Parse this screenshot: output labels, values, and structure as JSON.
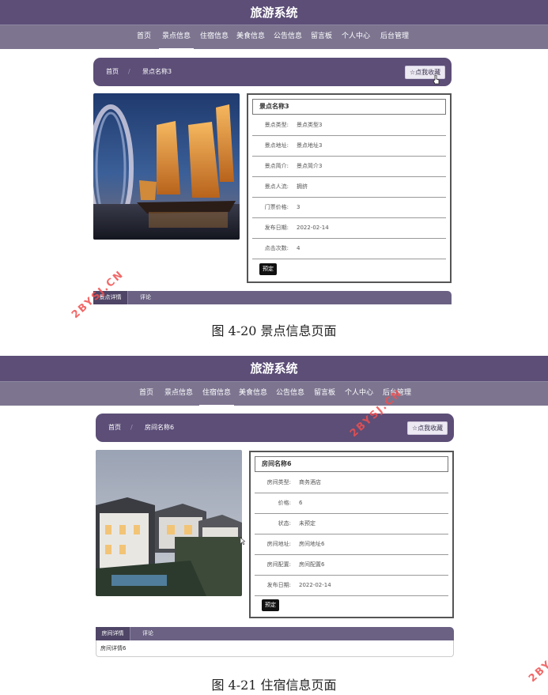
{
  "screens": [
    {
      "site_title": "旅游系统",
      "nav": [
        "首页",
        "景点信息",
        "住宿信息",
        "美食信息",
        "公告信息",
        "留言板",
        "个人中心",
        "后台管理"
      ],
      "active_nav_index": 1,
      "breadcrumb": {
        "home": "首页",
        "separator": "/",
        "current": "景点名称3"
      },
      "favorite_button": "☆点我收藏",
      "info_title": "景点名称3",
      "fields": [
        {
          "label": "景点类型:",
          "value": "景点类型3"
        },
        {
          "label": "景点地址:",
          "value": "景点地址3"
        },
        {
          "label": "景点简介:",
          "value": "景点简介3"
        },
        {
          "label": "景点人流:",
          "value": "拥挤"
        },
        {
          "label": "门票价格:",
          "value": "3"
        },
        {
          "label": "发布日期:",
          "value": "2022-02-14"
        },
        {
          "label": "点击次数:",
          "value": "4"
        }
      ],
      "book_button": "预定",
      "tabs": [
        "景点详情",
        "评论"
      ],
      "caption": "图 4-20 景点信息页面"
    },
    {
      "site_title": "旅游系统",
      "nav": [
        "首页",
        "景点信息",
        "住宿信息",
        "美食信息",
        "公告信息",
        "留言板",
        "个人中心",
        "后台管理"
      ],
      "active_nav_index": 2,
      "breadcrumb": {
        "home": "首页",
        "separator": "/",
        "current": "房间名称6"
      },
      "favorite_button": "☆点我收藏",
      "info_title": "房间名称6",
      "fields": [
        {
          "label": "房间类型:",
          "value": "商务酒店"
        },
        {
          "label": "价格:",
          "value": "6"
        },
        {
          "label": "状态:",
          "value": "未预定"
        },
        {
          "label": "房间地址:",
          "value": "房间地址6"
        },
        {
          "label": "房间配置:",
          "value": "房间配置6"
        },
        {
          "label": "发布日期:",
          "value": "2022-02-14"
        }
      ],
      "book_button": "预定",
      "tabs": [
        "房间详情",
        "评论"
      ],
      "detail_text": "房间详情6",
      "caption": "图 4-21 住宿信息页面"
    }
  ],
  "watermarks": [
    "2BYSJ.CN",
    "2BYSJ.CN",
    "2BY"
  ],
  "colors": {
    "header": "#5c4e77",
    "nav": "#7d7590",
    "accent_watermark": "#f05050"
  }
}
